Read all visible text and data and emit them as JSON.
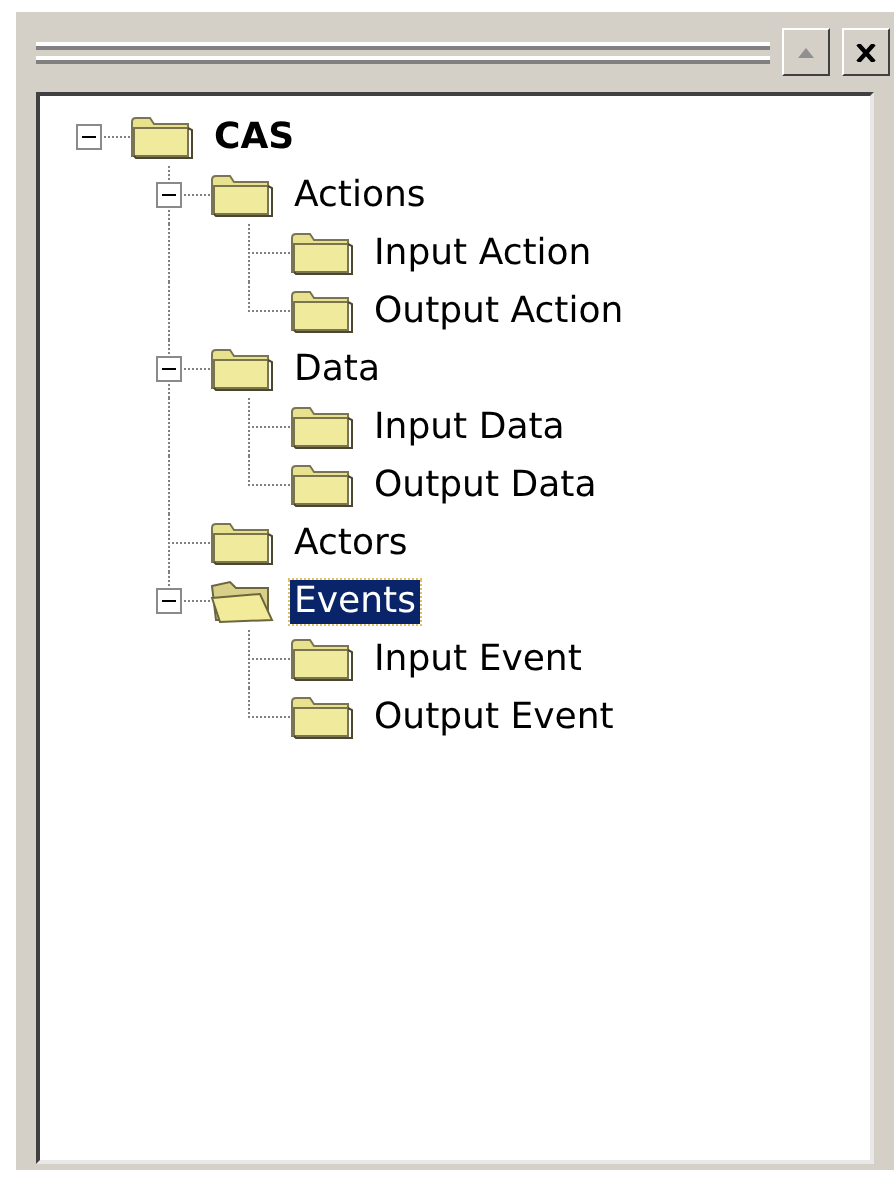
{
  "tree": [
    {
      "label": "CAS",
      "expanded": true,
      "selected": false,
      "children": [
        {
          "label": "Actions",
          "expanded": true,
          "selected": false,
          "children": [
            {
              "label": "Input Action",
              "selected": false
            },
            {
              "label": "Output Action",
              "selected": false
            }
          ]
        },
        {
          "label": "Data",
          "expanded": true,
          "selected": false,
          "children": [
            {
              "label": "Input Data",
              "selected": false
            },
            {
              "label": "Output Data",
              "selected": false
            }
          ]
        },
        {
          "label": "Actors",
          "selected": false
        },
        {
          "label": "Events",
          "expanded": true,
          "selected": true,
          "children": [
            {
              "label": "Input Event",
              "selected": false
            },
            {
              "label": "Output Event",
              "selected": false
            }
          ]
        }
      ]
    }
  ]
}
